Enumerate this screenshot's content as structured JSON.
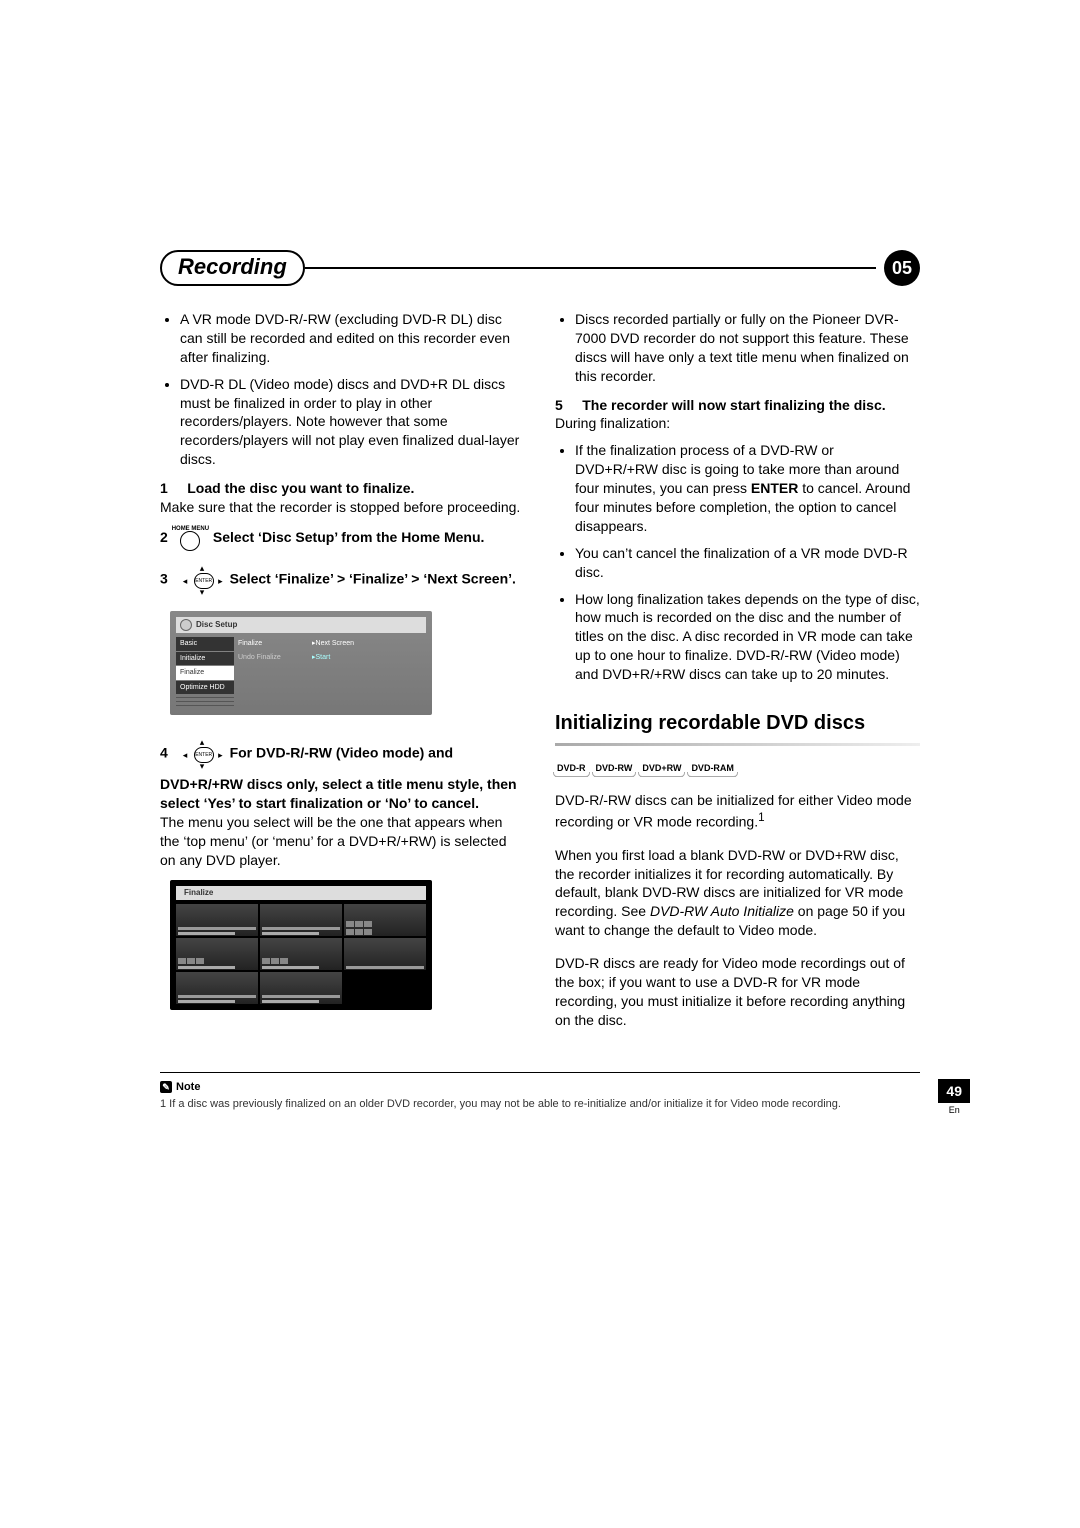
{
  "header": {
    "title": "Recording",
    "chapter": "05"
  },
  "left": {
    "bullets": [
      "A VR mode DVD-R/-RW (excluding DVD-R DL) disc can still be recorded and edited on this recorder even after finalizing.",
      "DVD-R DL (Video mode) discs and DVD+R DL discs must be finalized in order to play in other recorders/players. Note however that some recorders/players will not play even finalized dual-layer discs."
    ],
    "step1": {
      "num": "1",
      "title": "Load the disc you want to finalize.",
      "body": "Make sure that the recorder is stopped before proceeding."
    },
    "step2": {
      "num": "2",
      "icon_label": "HOME MENU",
      "title": "Select ‘Disc Setup’ from the Home Menu."
    },
    "step3": {
      "num": "3",
      "enter_label": "ENTER",
      "title": "Select ‘Finalize’ > ‘Finalize’ > ‘Next Screen’."
    },
    "disc_setup": {
      "header": "Disc Setup",
      "col1": [
        "Basic",
        "Initialize",
        "Finalize",
        "Optimize HDD"
      ],
      "selected": "Finalize",
      "col2": [
        "Finalize",
        "Undo Finalize"
      ],
      "col3": [
        "Next Screen",
        "Start"
      ]
    },
    "step4": {
      "num": "4",
      "enter_label": "ENTER",
      "title": "For DVD-R/-RW (Video mode) and DVD+R/+RW discs only, select a title menu style, then select ‘Yes’ to start finalization or ‘No’ to cancel.",
      "body": "The menu you select will be the one that appears when the ‘top menu’ (or ‘menu’ for a DVD+R/+RW) is selected on any DVD player."
    },
    "finalize_header": "Finalize"
  },
  "right": {
    "top_bullet": "Discs recorded partially or fully on the Pioneer DVR-7000 DVD recorder do not support this feature. These discs will have only a text title menu when finalized on this recorder.",
    "step5": {
      "num": "5",
      "title": "The recorder will now start finalizing the disc.",
      "lead": "During finalization:"
    },
    "step5_bullets": [
      "If the finalization process of a DVD-RW or DVD+R/+RW disc is going to take more than around four minutes, you can press ENTER to cancel. Around four minutes before completion, the option to cancel disappears.",
      "You can’t cancel the finalization of a VR mode DVD-R disc.",
      "How long finalization takes depends on the type of disc, how much is recorded on the disc and the number of titles on the disc. A disc recorded in VR mode can take up to one hour to finalize. DVD-R/-RW (Video mode) and DVD+R/+RW discs can take up to 20 minutes."
    ],
    "section_title": "Initializing recordable DVD discs",
    "formats": [
      "DVD-R",
      "DVD-RW",
      "DVD+RW",
      "DVD-RAM"
    ],
    "paras": [
      {
        "text": "DVD-R/-RW discs can be initialized for either Video mode recording or VR mode recording.",
        "sup": "1"
      },
      {
        "text": "When you first load a blank DVD-RW or DVD+RW disc, the recorder initializes it for recording automatically. By default, blank DVD-RW discs are initialized for VR mode recording. See DVD-RW Auto Initialize on page 50 if you want to change the default to Video mode."
      },
      {
        "text": "DVD-R discs are ready for Video mode recordings out of the box; if you want to use a DVD-R for VR mode recording, you must initialize it before recording anything on the disc."
      }
    ]
  },
  "note": {
    "label": "Note",
    "text": "1 If a disc was previously finalized on an older DVD recorder, you may not be able to re-initialize and/or initialize it for Video mode recording."
  },
  "footer": {
    "page": "49",
    "lang": "En"
  }
}
